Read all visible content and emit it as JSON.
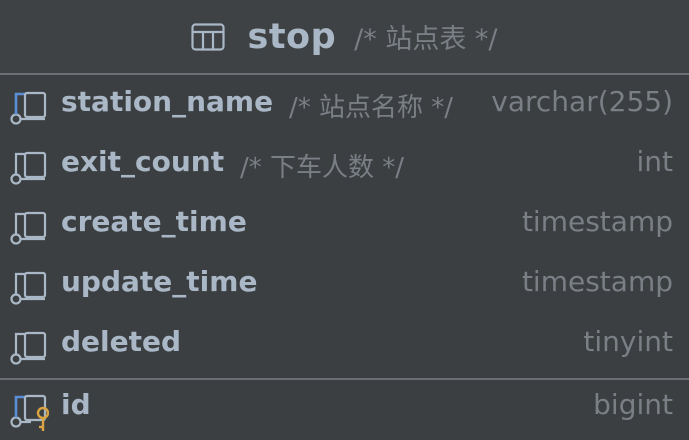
{
  "table": {
    "name": "stop",
    "comment": "/* 站点表 */",
    "icon": "table-icon"
  },
  "columns": [
    {
      "name": "station_name",
      "comment": "/* 站点名称 */",
      "type": "varchar(255)",
      "icon": "column-icon-highlighted"
    },
    {
      "name": "exit_count",
      "comment": "/* 下车人数 */",
      "type": "int",
      "icon": "column-icon"
    },
    {
      "name": "create_time",
      "comment": "",
      "type": "timestamp",
      "icon": "column-icon"
    },
    {
      "name": "update_time",
      "comment": "",
      "type": "timestamp",
      "icon": "column-icon"
    },
    {
      "name": "deleted",
      "comment": "",
      "type": "tinyint",
      "icon": "column-icon"
    }
  ],
  "primary_key": {
    "name": "id",
    "type": "bigint",
    "icon": "primary-key-column-icon"
  },
  "colors": {
    "background": "#3c3f41",
    "text": "#a9b7c6",
    "muted": "#7a7e85",
    "accent_blue": "#5a8fd6",
    "key_yellow": "#d9a441"
  }
}
